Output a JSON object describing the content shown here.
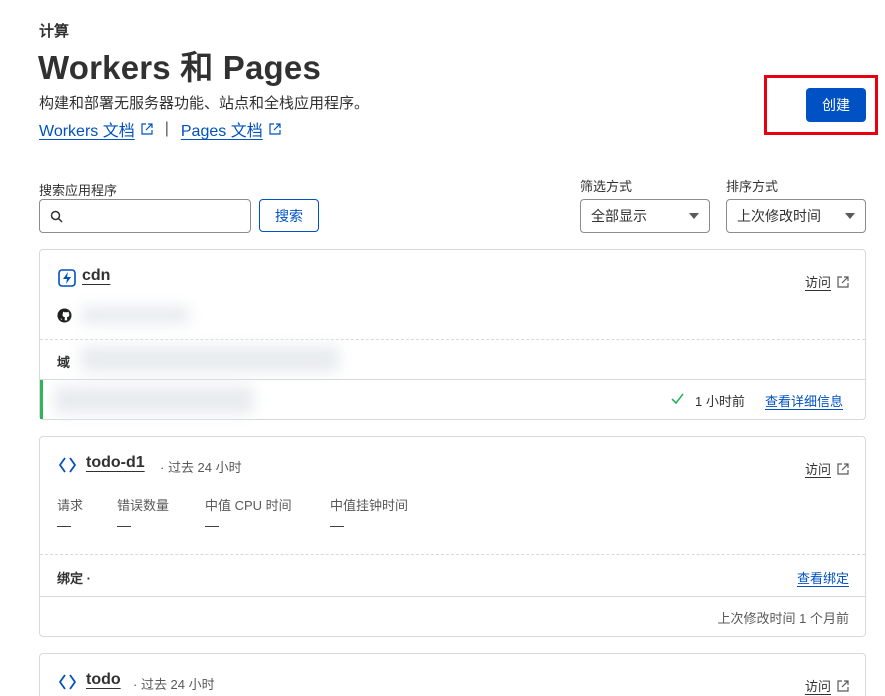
{
  "header": {
    "section": "计算",
    "title": "Workers 和 Pages",
    "description": "构建和部署无服务器功能、站点和全栈应用程序。",
    "doc_links": [
      "Workers 文档",
      "Pages 文档"
    ],
    "doc_separator": "|",
    "create_label": "创建"
  },
  "search": {
    "label": "搜索应用程序",
    "value": "",
    "placeholder": "",
    "button_label": "搜索"
  },
  "filter": {
    "label": "筛选方式",
    "selected": "全部显示"
  },
  "sort": {
    "label": "排序方式",
    "selected": "上次修改时间"
  },
  "apps": [
    {
      "name": "cdn",
      "icon": "pages-lightning-icon",
      "visit_label": "访问",
      "domain_label": "域",
      "status_time": "1 小时前",
      "details_label": "查看详细信息"
    },
    {
      "name": "todo-d1",
      "icon": "workers-chevrons-icon",
      "range": "· 过去 24 小时",
      "visit_label": "访问",
      "metrics": [
        {
          "label": "请求",
          "value": "—"
        },
        {
          "label": "错误数量",
          "value": "—"
        },
        {
          "label": "中值 CPU 时间",
          "value": "—"
        },
        {
          "label": "中值挂钟时间",
          "value": "—"
        }
      ],
      "bindings_label": "绑定 ·",
      "view_bindings_label": "查看绑定",
      "modified": "上次修改时间 1 个月前"
    },
    {
      "name": "todo",
      "icon": "workers-chevrons-icon",
      "range": "· 过去 24 小时",
      "visit_label": "访问"
    }
  ],
  "colors": {
    "accent": "#0051c3",
    "highlight": "#e60012",
    "success": "#2db35d"
  }
}
